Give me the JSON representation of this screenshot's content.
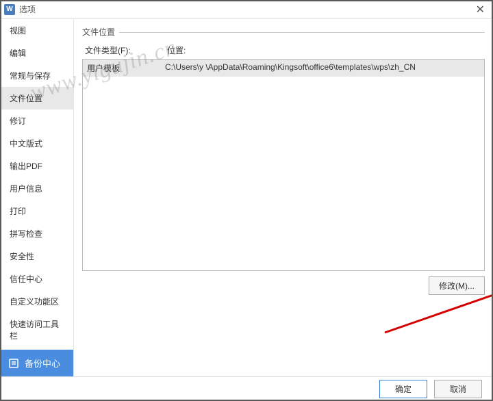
{
  "titlebar": {
    "icon_text": "W",
    "title": "选项"
  },
  "sidebar": {
    "items": [
      {
        "label": "视图"
      },
      {
        "label": "编辑"
      },
      {
        "label": "常规与保存"
      },
      {
        "label": "文件位置"
      },
      {
        "label": "修订"
      },
      {
        "label": "中文版式"
      },
      {
        "label": "输出PDF"
      },
      {
        "label": "用户信息"
      },
      {
        "label": "打印"
      },
      {
        "label": "拼写检查"
      },
      {
        "label": "安全性"
      },
      {
        "label": "信任中心"
      },
      {
        "label": "自定义功能区"
      },
      {
        "label": "快速访问工具栏"
      }
    ],
    "selected_index": 3,
    "backup_label": "备份中心"
  },
  "content": {
    "group_title": "文件位置",
    "col1_label": "文件类型(F):",
    "col2_label": "位置:",
    "rows": [
      {
        "type": "用户模板",
        "path": "C:\\Users\\y        \\AppData\\Roaming\\Kingsoft\\office6\\templates\\wps\\zh_CN"
      }
    ],
    "modify_label": "修改(M)..."
  },
  "footer": {
    "ok_label": "确定",
    "cancel_label": "取消"
  },
  "watermark": "www.yigujin.cn"
}
